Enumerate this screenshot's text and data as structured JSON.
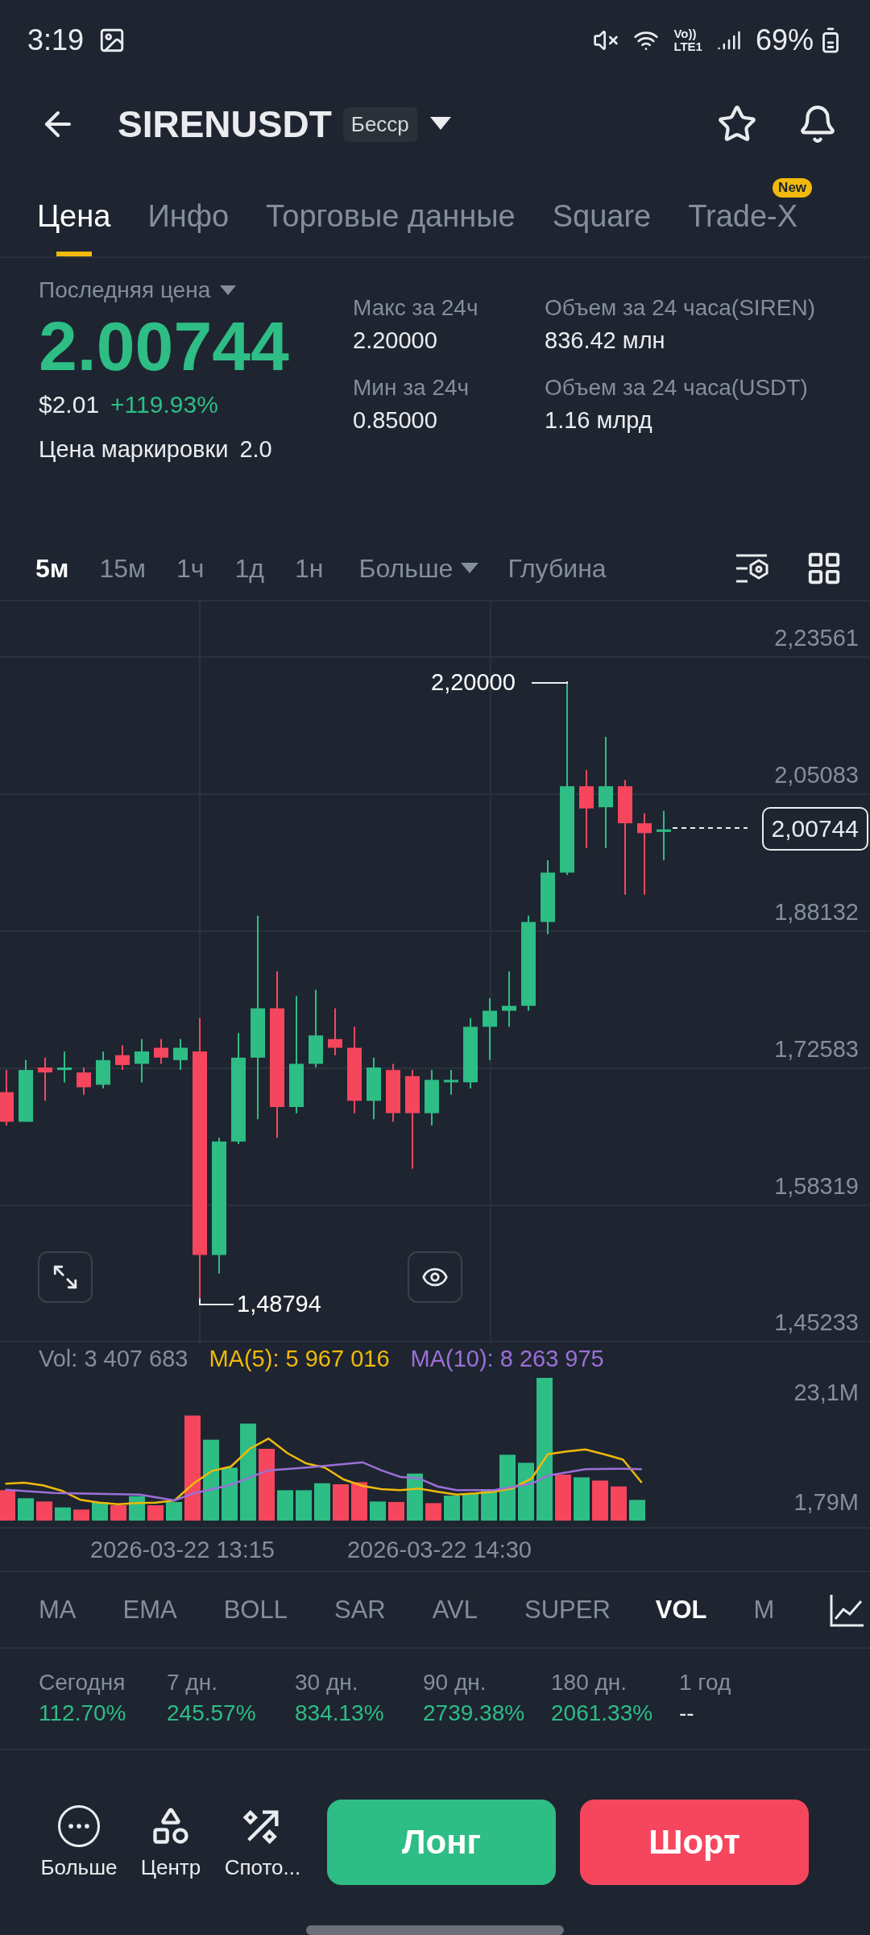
{
  "status_bar": {
    "time": "3:19",
    "network_top": "Vo))",
    "network_bottom": "LTE1",
    "battery": "69%"
  },
  "header": {
    "symbol": "SIRENUSDT",
    "badge": "Бесср"
  },
  "tabs": [
    {
      "label": "Цена",
      "selected": true
    },
    {
      "label": "Инфо",
      "selected": false
    },
    {
      "label": "Торговые данные",
      "selected": false
    },
    {
      "label": "Square",
      "selected": false
    },
    {
      "label": "Trade-X",
      "selected": false,
      "badge": "New"
    }
  ],
  "price": {
    "label": "Последняя цена",
    "last": "2.00744",
    "usd": "$2.01",
    "change": "+119.93%",
    "mark_label": "Цена маркировки",
    "mark_value": "2.0"
  },
  "stats": [
    {
      "label": "Макс за 24ч",
      "value": "2.20000"
    },
    {
      "label": "Объем за 24 часа(SIREN)",
      "value": "836.42 млн"
    },
    {
      "label": "Мин за 24ч",
      "value": "0.85000"
    },
    {
      "label": "Объем за 24 часа(USDT)",
      "value": "1.16 млрд"
    }
  ],
  "intervals": [
    {
      "label": "5м",
      "selected": true
    },
    {
      "label": "15м",
      "selected": false
    },
    {
      "label": "1ч",
      "selected": false
    },
    {
      "label": "1д",
      "selected": false
    },
    {
      "label": "1н",
      "selected": false
    }
  ],
  "more": "Больше",
  "depth": "Глубина",
  "chart": {
    "y_ticks": [
      "2,23561",
      "2,05083",
      "1,88132",
      "1,72583",
      "1,58319",
      "1,45233"
    ],
    "high_label": "2,20000",
    "low_label": "1,48794",
    "current": "2,00744"
  },
  "volume": {
    "vol": "Vol: 3 407 683",
    "ma5": "MA(5): 5 967 016",
    "ma10": "MA(10): 8 263 975",
    "y_ticks": [
      "23,1M",
      "1,79M"
    ],
    "dates": [
      "2026-03-22 13:15",
      "2026-03-22 14:30"
    ]
  },
  "indicators": [
    {
      "label": "MA",
      "selected": false
    },
    {
      "label": "EMA",
      "selected": false
    },
    {
      "label": "BOLL",
      "selected": false
    },
    {
      "label": "SAR",
      "selected": false
    },
    {
      "label": "AVL",
      "selected": false
    },
    {
      "label": "SUPER",
      "selected": false
    },
    {
      "label": "VOL",
      "selected": true
    },
    {
      "label": "M",
      "selected": false
    }
  ],
  "performance": [
    {
      "period": "Сегодня",
      "value": "112.70%",
      "kind": "up"
    },
    {
      "period": "7 дн.",
      "value": "245.57%",
      "kind": "up"
    },
    {
      "period": "30 дн.",
      "value": "834.13%",
      "kind": "up"
    },
    {
      "period": "90 дн.",
      "value": "2739.38%",
      "kind": "up"
    },
    {
      "period": "180 дн.",
      "value": "2061.33%",
      "kind": "up"
    },
    {
      "period": "1 год",
      "value": "--",
      "kind": "none"
    }
  ],
  "actions": [
    {
      "label": "Больше",
      "kind": "more"
    },
    {
      "label": "Центр",
      "kind": "center"
    },
    {
      "label": "Спото...",
      "kind": "spot"
    }
  ],
  "buttons": {
    "long": "Лонг",
    "short": "Шорт"
  }
}
